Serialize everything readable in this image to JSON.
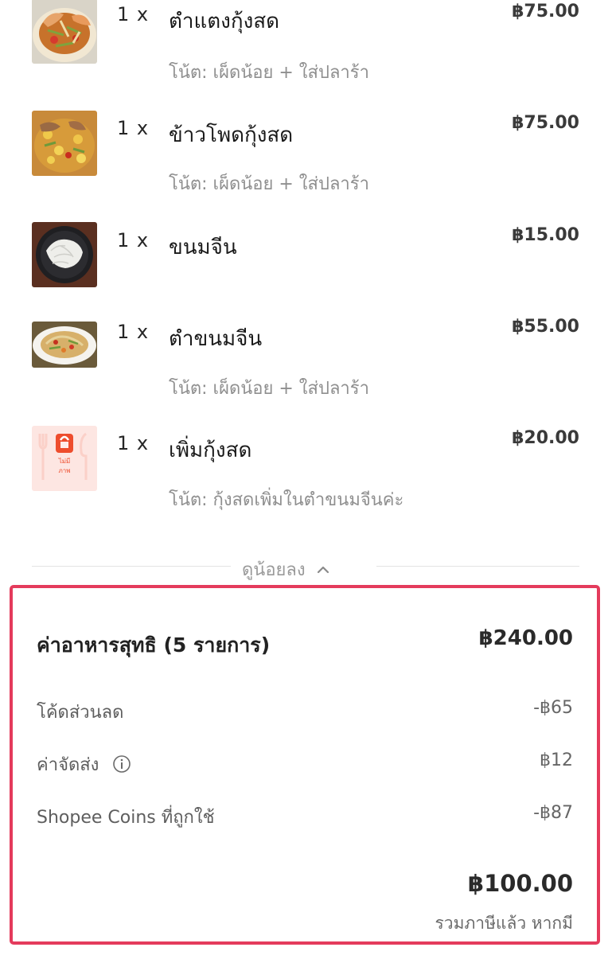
{
  "order_items": [
    {
      "qty": "1 x",
      "name": "ตำแตงกุ้งสด",
      "price": "฿75.00",
      "note": "โน้ต: เผ็ดน้อย + ใส่ปลาร้า",
      "image": "papaya-salad-shrimp-photo"
    },
    {
      "qty": "1 x",
      "name": "ข้าวโพดกุ้งสด",
      "price": "฿75.00",
      "note": "โน้ต: เผ็ดน้อย + ใส่ปลาร้า",
      "image": "corn-salad-shrimp-photo"
    },
    {
      "qty": "1 x",
      "name": "ขนมจีน",
      "price": "฿15.00",
      "note": "",
      "image": "rice-noodles-photo"
    },
    {
      "qty": "1 x",
      "name": "ตำขนมจีน",
      "price": "฿55.00",
      "note": "โน้ต: เผ็ดน้อย + ใส่ปลาร้า",
      "image": "noodle-papaya-salad-photo"
    },
    {
      "qty": "1 x",
      "name": "เพิ่มกุ้งสด",
      "price": "฿20.00",
      "note": "โน้ต: กุ้งสดเพิ่มในตำขนมจีนค่ะ",
      "image": "no-image-placeholder"
    }
  ],
  "placeholder_text": {
    "line1": "ไม่มี",
    "line2": "ภาพ"
  },
  "collapse": {
    "label": "ดูน้อยลง",
    "icon": "chevron-up-icon"
  },
  "summary": {
    "subtotal_label": "ค่าอาหารสุทธิ (5 รายการ)",
    "subtotal_value": "฿240.00",
    "discount_label": "โค้ดส่วนลด",
    "discount_value": "-฿65",
    "delivery_label": "ค่าจัดส่ง",
    "delivery_value": "฿12",
    "delivery_info_icon": "info-icon",
    "coins_label": "Shopee Coins ที่ถูกใช้",
    "coins_value": "-฿87",
    "total_value": "฿100.00",
    "tax_note": "รวมภาษีแล้ว หากมี"
  },
  "colors": {
    "highlight_border": "#e43b5c",
    "shopee_orange": "#ee4d2d"
  }
}
